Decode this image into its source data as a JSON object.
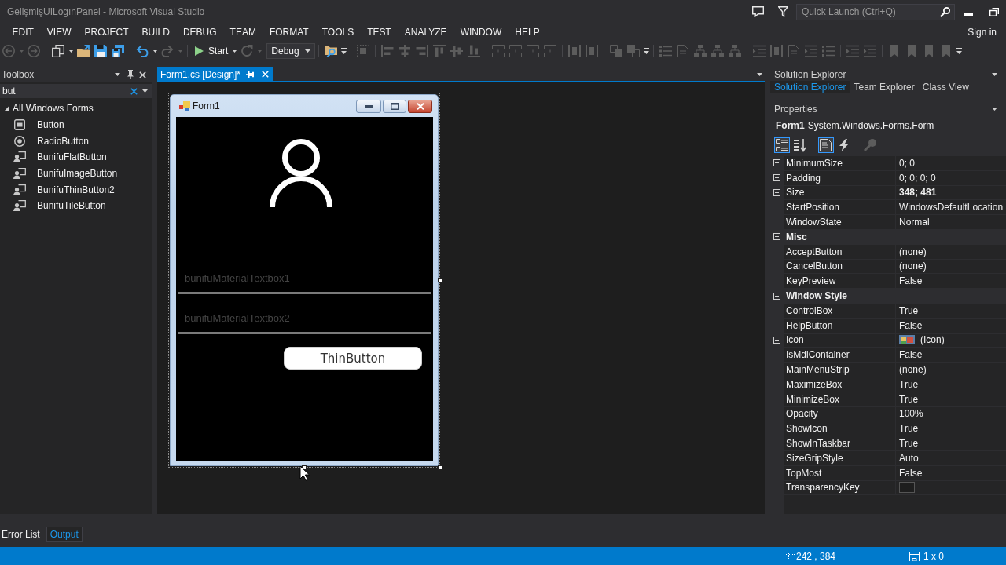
{
  "window": {
    "title": "GelişmişUILogınPanel - Microsoft Visual Studio",
    "quick_launch": {
      "placeholder": "Quick Launch (Ctrl+Q)"
    }
  },
  "menu": [
    "EDIT",
    "VIEW",
    "PROJECT",
    "BUILD",
    "DEBUG",
    "TEAM",
    "FORMAT",
    "TOOLS",
    "TEST",
    "ANALYZE",
    "WINDOW",
    "HELP"
  ],
  "account": {
    "label": "Sign in"
  },
  "toolbar": [
    [
      {
        "kind": "back",
        "disabled": true
      },
      {
        "kind": "caret",
        "disabled": true
      },
      {
        "kind": "forward",
        "disabled": true
      }
    ],
    [
      {
        "kind": "new-project",
        "disabled": false
      },
      {
        "kind": "caret",
        "disabled": false
      },
      {
        "kind": "open",
        "disabled": false
      },
      {
        "kind": "save",
        "disabled": false
      },
      {
        "kind": "save-all",
        "disabled": false
      }
    ],
    [
      {
        "kind": "undo",
        "disabled": false
      },
      {
        "kind": "caret",
        "disabled": false
      },
      {
        "kind": "redo",
        "disabled": true
      },
      {
        "kind": "caret",
        "disabled": true
      }
    ],
    [
      {
        "kind": "start",
        "label": "Start",
        "disabled": false
      },
      {
        "kind": "caret",
        "disabled": false
      },
      {
        "kind": "restart",
        "disabled": true
      },
      {
        "kind": "caret",
        "disabled": true
      },
      {
        "kind": "config",
        "value": "Debug",
        "disabled": false
      }
    ],
    [
      {
        "kind": "find",
        "disabled": false
      },
      {
        "kind": "overflow",
        "disabled": false
      }
    ],
    [
      {
        "kind": "grid-align",
        "disabled": true
      }
    ],
    [
      {
        "kind": "align-left",
        "disabled": true
      },
      {
        "kind": "align-center",
        "disabled": true
      },
      {
        "kind": "align-right",
        "disabled": true
      },
      {
        "kind": "align-top",
        "disabled": true
      },
      {
        "kind": "align-middle",
        "disabled": true
      },
      {
        "kind": "align-bottom",
        "disabled": true
      }
    ],
    [
      {
        "kind": "same-size",
        "disabled": true
      },
      {
        "kind": "same-size",
        "disabled": true
      },
      {
        "kind": "same-size",
        "disabled": true
      },
      {
        "kind": "same-size",
        "disabled": true
      }
    ],
    [
      {
        "kind": "spacing",
        "disabled": true
      },
      {
        "kind": "spacing",
        "disabled": true
      }
    ],
    [
      {
        "kind": "bring-front",
        "disabled": true
      },
      {
        "kind": "send-back",
        "disabled": true
      },
      {
        "kind": "overflow",
        "disabled": false
      }
    ],
    [
      {
        "kind": "list",
        "disabled": true
      },
      {
        "kind": "document",
        "disabled": true
      },
      {
        "kind": "tree",
        "disabled": true
      },
      {
        "kind": "tree",
        "disabled": true
      },
      {
        "kind": "tree",
        "disabled": true
      }
    ],
    [
      {
        "kind": "indent",
        "disabled": true
      },
      {
        "kind": "spacing",
        "disabled": true
      },
      {
        "kind": "document",
        "disabled": true
      },
      {
        "kind": "indent",
        "disabled": true
      },
      {
        "kind": "list",
        "disabled": true
      }
    ],
    [
      {
        "kind": "indent",
        "disabled": true
      },
      {
        "kind": "indent",
        "disabled": true
      }
    ],
    [
      {
        "kind": "bookmark",
        "disabled": true
      },
      {
        "kind": "bookmark",
        "disabled": true
      },
      {
        "kind": "bookmark",
        "disabled": true
      },
      {
        "kind": "bookmark",
        "disabled": true
      },
      {
        "kind": "overflow",
        "disabled": false
      }
    ]
  ],
  "toolbox": {
    "title": "Toolbox",
    "search": {
      "value": "but"
    },
    "groups": [
      {
        "label": "All Windows Forms",
        "expanded": true,
        "children": [
          {
            "label": "Button",
            "kind": "button",
            "selected": false
          },
          {
            "label": "RadioButton",
            "kind": "radio",
            "selected": false
          },
          {
            "label": "BunifuFlatButton",
            "kind": "component",
            "selected": false
          },
          {
            "label": "BunifuImageButton",
            "kind": "component",
            "selected": false
          },
          {
            "label": "BunifuThinButton2",
            "kind": "component",
            "selected": false
          },
          {
            "label": "BunifuTileButton",
            "kind": "component",
            "selected": false
          }
        ]
      }
    ]
  },
  "document_tabs": [
    {
      "label": "Form1.cs [Design]*",
      "selected": true
    }
  ],
  "designer": {
    "form": {
      "title": "Form1",
      "selected": true,
      "textboxes": [
        {
          "placeholder": "bunifuMaterialTextbox1"
        },
        {
          "placeholder": "bunifuMaterialTextbox2"
        }
      ],
      "button": {
        "label": "ThinButton"
      }
    }
  },
  "solution_explorer": {
    "title": "Solution Explorer",
    "tabs": [
      {
        "label": "Solution Explorer",
        "selected": true
      },
      {
        "label": "Team Explorer",
        "selected": false
      },
      {
        "label": "Class View",
        "selected": false
      }
    ]
  },
  "properties": {
    "title": "Properties",
    "object": {
      "name": "Form1",
      "type": "System.Windows.Forms.Form"
    },
    "toolbar": [
      {
        "kind": "categorized",
        "selected": true,
        "disabled": false
      },
      {
        "kind": "alphabetical",
        "selected": false,
        "disabled": false
      },
      {
        "kind": "properties",
        "selected": true,
        "disabled": false
      },
      {
        "kind": "events",
        "selected": false,
        "disabled": false
      },
      {
        "kind": "property-pages",
        "selected": false,
        "disabled": true
      }
    ],
    "rows": [
      {
        "kind": "text",
        "name": "MinimumSize",
        "value": "0; 0",
        "expandable": true,
        "modified": false
      },
      {
        "kind": "text",
        "name": "Padding",
        "value": "0; 0; 0; 0",
        "expandable": true,
        "modified": false
      },
      {
        "kind": "text",
        "name": "Size",
        "value": "348; 481",
        "expandable": true,
        "modified": true
      },
      {
        "kind": "text",
        "name": "StartPosition",
        "value": "WindowsDefaultLocation",
        "expandable": false,
        "modified": false
      },
      {
        "kind": "text",
        "name": "WindowState",
        "value": "Normal",
        "expandable": false,
        "modified": false
      }
    ],
    "categories": [
      {
        "name": "Misc",
        "expanded": true,
        "properties": [
          {
            "kind": "text",
            "name": "AcceptButton",
            "value": "(none)",
            "expandable": false,
            "modified": false
          },
          {
            "kind": "text",
            "name": "CancelButton",
            "value": "(none)",
            "expandable": false,
            "modified": false
          },
          {
            "kind": "text",
            "name": "KeyPreview",
            "value": "False",
            "expandable": false,
            "modified": false
          }
        ]
      },
      {
        "name": "Window Style",
        "expanded": true,
        "properties": [
          {
            "kind": "text",
            "name": "ControlBox",
            "value": "True",
            "expandable": false,
            "modified": false
          },
          {
            "kind": "text",
            "name": "HelpButton",
            "value": "False",
            "expandable": false,
            "modified": false
          },
          {
            "kind": "image",
            "name": "Icon",
            "value": "(Icon)",
            "expandable": true,
            "modified": false
          },
          {
            "kind": "text",
            "name": "IsMdiContainer",
            "value": "False",
            "expandable": false,
            "modified": false
          },
          {
            "kind": "text",
            "name": "MainMenuStrip",
            "value": "(none)",
            "expandable": false,
            "modified": false
          },
          {
            "kind": "text",
            "name": "MaximizeBox",
            "value": "True",
            "expandable": false,
            "modified": false
          },
          {
            "kind": "text",
            "name": "MinimizeBox",
            "value": "True",
            "expandable": false,
            "modified": false
          },
          {
            "kind": "text",
            "name": "Opacity",
            "value": "100%",
            "expandable": false,
            "modified": false
          },
          {
            "kind": "text",
            "name": "ShowIcon",
            "value": "True",
            "expandable": false,
            "modified": false
          },
          {
            "kind": "text",
            "name": "ShowInTaskbar",
            "value": "True",
            "expandable": false,
            "modified": false
          },
          {
            "kind": "text",
            "name": "SizeGripStyle",
            "value": "Auto",
            "expandable": false,
            "modified": false
          },
          {
            "kind": "text",
            "name": "TopMost",
            "value": "False",
            "expandable": false,
            "modified": false
          },
          {
            "kind": "color",
            "name": "TransparencyKey",
            "expandable": false,
            "modified": false
          }
        ]
      }
    ]
  },
  "bottom_tabs": [
    {
      "label": "Error List",
      "selected": false
    },
    {
      "label": "Output",
      "selected": true
    }
  ],
  "status_bar": {
    "position": "242 , 384",
    "size": "1 x 0"
  }
}
